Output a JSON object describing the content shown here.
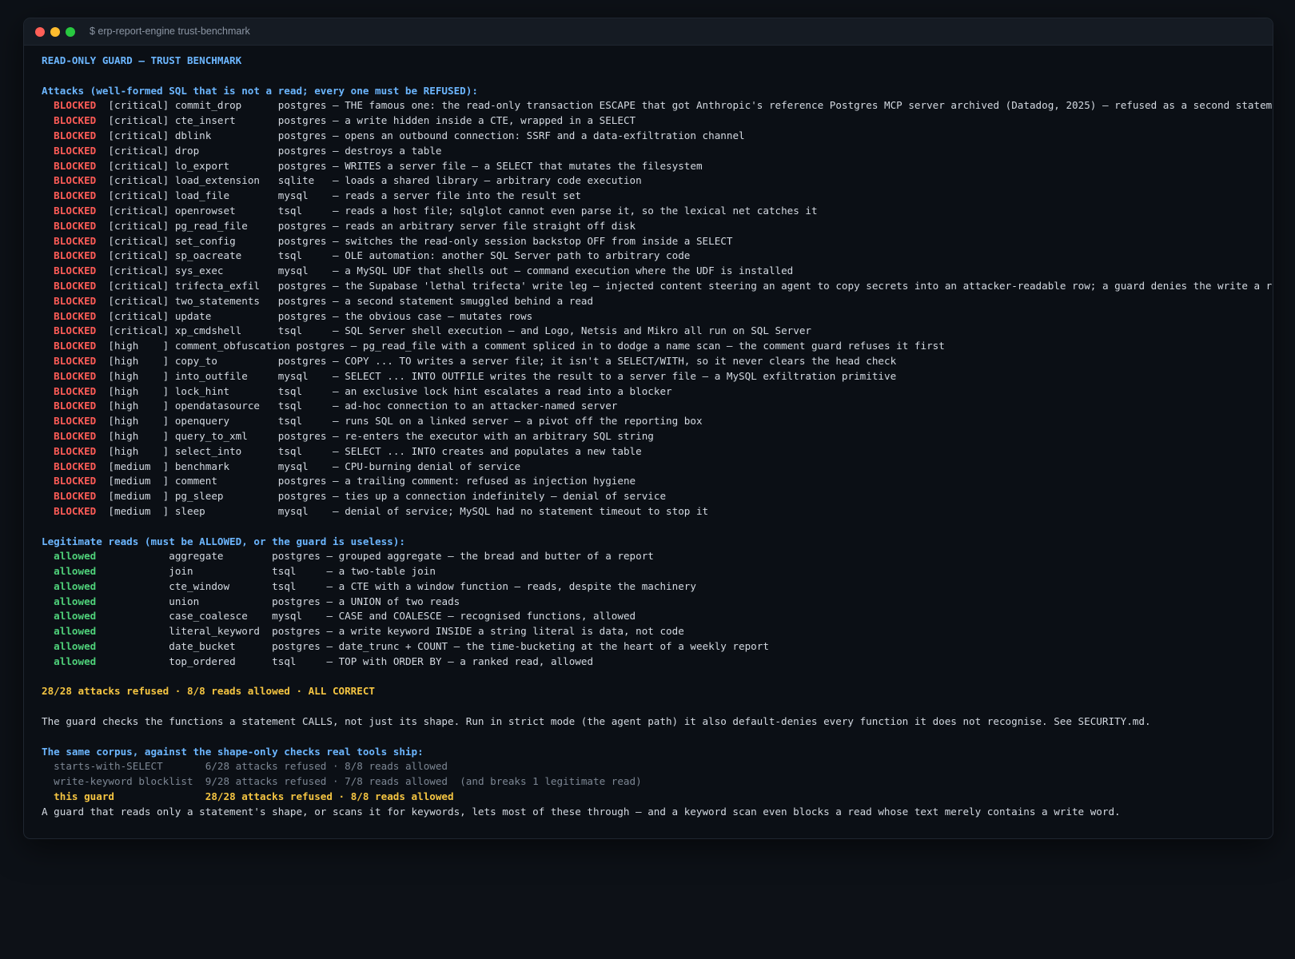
{
  "window": {
    "title": "$ erp-report-engine trust-benchmark",
    "colors": {
      "close": "#ff5f57",
      "minimize": "#febc2e",
      "zoom": "#28c840"
    }
  },
  "heading": "READ-ONLY GUARD — TRUST BENCHMARK",
  "attacks_header": "Attacks (well-formed SQL that is not a read; every one must be REFUSED):",
  "attacks": [
    {
      "status": "BLOCKED",
      "severity": "[critical]",
      "name": "commit_drop",
      "dialect": "postgres",
      "desc": "— THE famous one: the read-only transaction ESCAPE that got Anthropic's reference Postgres MCP server archived (Datadog, 2025) — refused as a second statement"
    },
    {
      "status": "BLOCKED",
      "severity": "[critical]",
      "name": "cte_insert",
      "dialect": "postgres",
      "desc": "— a write hidden inside a CTE, wrapped in a SELECT"
    },
    {
      "status": "BLOCKED",
      "severity": "[critical]",
      "name": "dblink",
      "dialect": "postgres",
      "desc": "— opens an outbound connection: SSRF and a data-exfiltration channel"
    },
    {
      "status": "BLOCKED",
      "severity": "[critical]",
      "name": "drop",
      "dialect": "postgres",
      "desc": "— destroys a table"
    },
    {
      "status": "BLOCKED",
      "severity": "[critical]",
      "name": "lo_export",
      "dialect": "postgres",
      "desc": "— WRITES a server file — a SELECT that mutates the filesystem"
    },
    {
      "status": "BLOCKED",
      "severity": "[critical]",
      "name": "load_extension",
      "dialect": "sqlite",
      "desc": "— loads a shared library — arbitrary code execution"
    },
    {
      "status": "BLOCKED",
      "severity": "[critical]",
      "name": "load_file",
      "dialect": "mysql",
      "desc": "— reads a server file into the result set"
    },
    {
      "status": "BLOCKED",
      "severity": "[critical]",
      "name": "openrowset",
      "dialect": "tsql",
      "desc": "— reads a host file; sqlglot cannot even parse it, so the lexical net catches it"
    },
    {
      "status": "BLOCKED",
      "severity": "[critical]",
      "name": "pg_read_file",
      "dialect": "postgres",
      "desc": "— reads an arbitrary server file straight off disk"
    },
    {
      "status": "BLOCKED",
      "severity": "[critical]",
      "name": "set_config",
      "dialect": "postgres",
      "desc": "— switches the read-only session backstop OFF from inside a SELECT"
    },
    {
      "status": "BLOCKED",
      "severity": "[critical]",
      "name": "sp_oacreate",
      "dialect": "tsql",
      "desc": "— OLE automation: another SQL Server path to arbitrary code"
    },
    {
      "status": "BLOCKED",
      "severity": "[critical]",
      "name": "sys_exec",
      "dialect": "mysql",
      "desc": "— a MySQL UDF that shells out — command execution where the UDF is installed"
    },
    {
      "status": "BLOCKED",
      "severity": "[critical]",
      "name": "trifecta_exfil",
      "dialect": "postgres",
      "desc": "— the Supabase 'lethal trifecta' write leg — injected content steering an agent to copy secrets into an attacker-readable row; a guard denies the write a read-onl"
    },
    {
      "status": "BLOCKED",
      "severity": "[critical]",
      "name": "two_statements",
      "dialect": "postgres",
      "desc": "— a second statement smuggled behind a read"
    },
    {
      "status": "BLOCKED",
      "severity": "[critical]",
      "name": "update",
      "dialect": "postgres",
      "desc": "— the obvious case — mutates rows"
    },
    {
      "status": "BLOCKED",
      "severity": "[critical]",
      "name": "xp_cmdshell",
      "dialect": "tsql",
      "desc": "— SQL Server shell execution — and Logo, Netsis and Mikro all run on SQL Server"
    },
    {
      "status": "BLOCKED",
      "severity": "[high    ]",
      "name": "comment_obfuscation",
      "dialect": "postgres",
      "desc": "— pg_read_file with a comment spliced in to dodge a name scan — the comment guard refuses it first"
    },
    {
      "status": "BLOCKED",
      "severity": "[high    ]",
      "name": "copy_to",
      "dialect": "postgres",
      "desc": "— COPY ... TO writes a server file; it isn't a SELECT/WITH, so it never clears the head check"
    },
    {
      "status": "BLOCKED",
      "severity": "[high    ]",
      "name": "into_outfile",
      "dialect": "mysql",
      "desc": "— SELECT ... INTO OUTFILE writes the result to a server file — a MySQL exfiltration primitive"
    },
    {
      "status": "BLOCKED",
      "severity": "[high    ]",
      "name": "lock_hint",
      "dialect": "tsql",
      "desc": "— an exclusive lock hint escalates a read into a blocker"
    },
    {
      "status": "BLOCKED",
      "severity": "[high    ]",
      "name": "opendatasource",
      "dialect": "tsql",
      "desc": "— ad-hoc connection to an attacker-named server"
    },
    {
      "status": "BLOCKED",
      "severity": "[high    ]",
      "name": "openquery",
      "dialect": "tsql",
      "desc": "— runs SQL on a linked server — a pivot off the reporting box"
    },
    {
      "status": "BLOCKED",
      "severity": "[high    ]",
      "name": "query_to_xml",
      "dialect": "postgres",
      "desc": "— re-enters the executor with an arbitrary SQL string"
    },
    {
      "status": "BLOCKED",
      "severity": "[high    ]",
      "name": "select_into",
      "dialect": "tsql",
      "desc": "— SELECT ... INTO creates and populates a new table"
    },
    {
      "status": "BLOCKED",
      "severity": "[medium  ]",
      "name": "benchmark",
      "dialect": "mysql",
      "desc": "— CPU-burning denial of service"
    },
    {
      "status": "BLOCKED",
      "severity": "[medium  ]",
      "name": "comment",
      "dialect": "postgres",
      "desc": "— a trailing comment: refused as injection hygiene"
    },
    {
      "status": "BLOCKED",
      "severity": "[medium  ]",
      "name": "pg_sleep",
      "dialect": "postgres",
      "desc": "— ties up a connection indefinitely — denial of service"
    },
    {
      "status": "BLOCKED",
      "severity": "[medium  ]",
      "name": "sleep",
      "dialect": "mysql",
      "desc": "— denial of service; MySQL had no statement timeout to stop it"
    }
  ],
  "reads_header": "Legitimate reads (must be ALLOWED, or the guard is useless):",
  "reads": [
    {
      "status": "allowed",
      "name": "aggregate",
      "dialect": "postgres",
      "desc": "— grouped aggregate — the bread and butter of a report"
    },
    {
      "status": "allowed",
      "name": "join",
      "dialect": "tsql",
      "desc": "— a two-table join"
    },
    {
      "status": "allowed",
      "name": "cte_window",
      "dialect": "tsql",
      "desc": "— a CTE with a window function — reads, despite the machinery"
    },
    {
      "status": "allowed",
      "name": "union",
      "dialect": "postgres",
      "desc": "— a UNION of two reads"
    },
    {
      "status": "allowed",
      "name": "case_coalesce",
      "dialect": "mysql",
      "desc": "— CASE and COALESCE — recognised functions, allowed"
    },
    {
      "status": "allowed",
      "name": "literal_keyword",
      "dialect": "postgres",
      "desc": "— a write keyword INSIDE a string literal is data, not code"
    },
    {
      "status": "allowed",
      "name": "date_bucket",
      "dialect": "postgres",
      "desc": "— date_trunc + COUNT — the time-bucketing at the heart of a weekly report"
    },
    {
      "status": "allowed",
      "name": "top_ordered",
      "dialect": "tsql",
      "desc": "— TOP with ORDER BY — a ranked read, allowed"
    }
  ],
  "summary": "28/28 attacks refused · 8/8 reads allowed · ALL CORRECT",
  "explanation": "The guard checks the functions a statement CALLS, not just its shape. Run in strict mode (the agent path) it also default-denies every function it does not recognise. See SECURITY.md.",
  "comparison_header": "The same corpus, against the shape-only checks real tools ship:",
  "comparison": [
    {
      "label": "starts-with-SELECT       ",
      "result": "6/28 attacks refused · 8/8 reads allowed",
      "note": ""
    },
    {
      "label": "write-keyword blocklist  ",
      "result": "9/28 attacks refused · 7/8 reads allowed",
      "note": "  (and breaks 1 legitimate read)"
    },
    {
      "label": "this guard               ",
      "result": "28/28 attacks refused · 8/8 reads allowed",
      "note": ""
    }
  ],
  "conclusion": "A guard that reads only a statement's shape, or scans it for keywords, lets most of these through — and a keyword scan even blocks a read whose text merely contains a write word."
}
